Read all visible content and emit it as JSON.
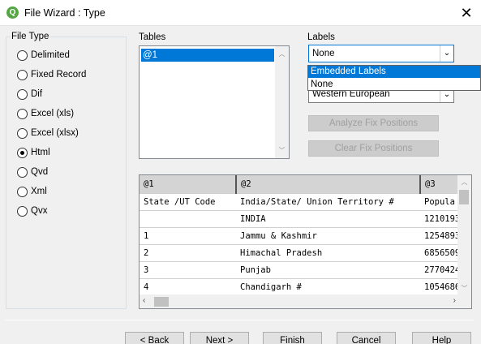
{
  "window": {
    "title": "File Wizard : Type",
    "app_icon_letter": "Q"
  },
  "file_type": {
    "legend": "File Type",
    "options": [
      "Delimited",
      "Fixed Record",
      "Dif",
      "Excel (xls)",
      "Excel (xlsx)",
      "Html",
      "Qvd",
      "Xml",
      "Qvx"
    ],
    "selected": "Html"
  },
  "tables": {
    "label": "Tables",
    "items": [
      "@1"
    ],
    "selected": "@1"
  },
  "labels": {
    "label": "Labels",
    "value": "None",
    "dropdown_options": [
      "Embedded Labels",
      "None"
    ],
    "highlighted": "Embedded Labels"
  },
  "character_set": {
    "value": "Western European"
  },
  "buttons": {
    "analyze_fix": "Analyze Fix Positions",
    "clear_fix": "Clear Fix Positions",
    "back": "< Back",
    "next": "Next >",
    "finish": "Finish",
    "cancel": "Cancel",
    "help": "Help"
  },
  "preview": {
    "columns": [
      "@1",
      "@2",
      "@3"
    ],
    "rows": [
      [
        "State  /UT Code",
        "India/State/  Union Territory #",
        "Popula"
      ],
      [
        "",
        "INDIA",
        "1210193"
      ],
      [
        "1",
        "Jammu & Kashmir",
        "1254893"
      ],
      [
        "2",
        "Himachal Pradesh",
        "6856509"
      ],
      [
        "3",
        "Punjab",
        "2770424"
      ],
      [
        "4",
        "Chandigarh #",
        "1054686"
      ]
    ]
  }
}
